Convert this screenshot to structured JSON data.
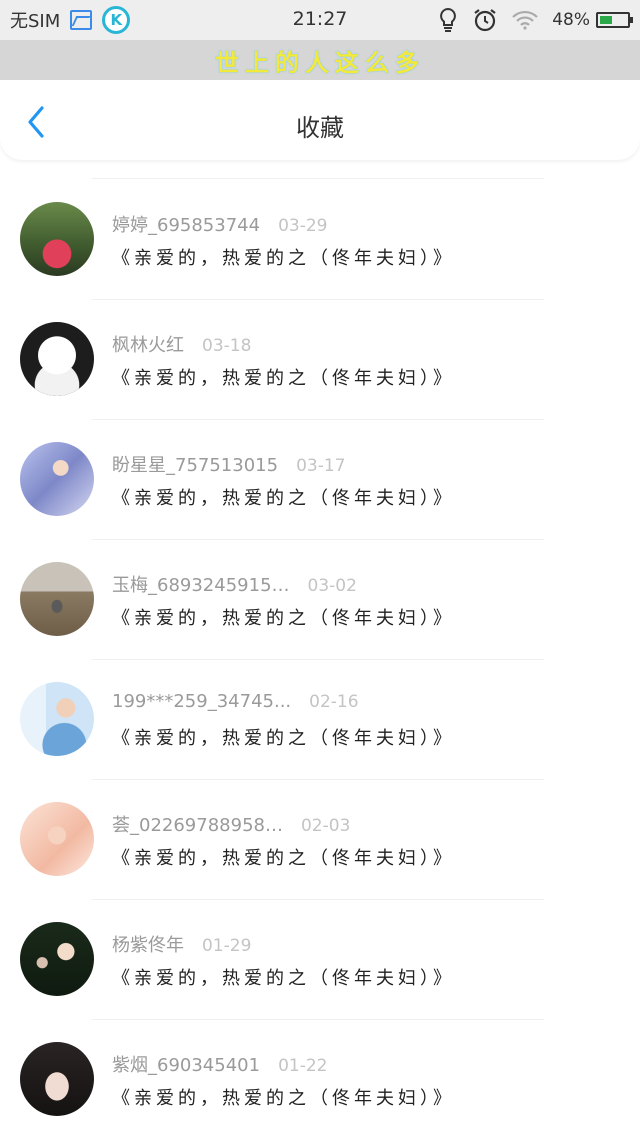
{
  "status_bar": {
    "carrier": "无SIM",
    "time": "21:27",
    "battery": "48%",
    "battery_level": 0.48,
    "app_icon_letter": "K"
  },
  "banner": {
    "text": "世上的人这么多"
  },
  "nav": {
    "title": "收藏",
    "back_icon": "chevron-left-icon"
  },
  "items": [
    {
      "name": "婷婷_695853744",
      "date": "03-29",
      "song": "《亲爱的，热爱的之（佟年夫妇）》"
    },
    {
      "name": "枫林火红",
      "date": "03-18",
      "song": "《亲爱的，热爱的之（佟年夫妇）》"
    },
    {
      "name": "盼星星_757513015",
      "date": "03-17",
      "song": "《亲爱的，热爱的之（佟年夫妇）》"
    },
    {
      "name": "玉梅_6893245915…",
      "date": "03-02",
      "song": "《亲爱的，热爱的之（佟年夫妇）》"
    },
    {
      "name": "199***259_34745...",
      "date": "02-16",
      "song": "《亲爱的，热爱的之（佟年夫妇）》"
    },
    {
      "name": "荟_02269788958…",
      "date": "02-03",
      "song": "《亲爱的，热爱的之（佟年夫妇）》"
    },
    {
      "name": "杨紫佟年",
      "date": "01-29",
      "song": "《亲爱的，热爱的之（佟年夫妇）》"
    },
    {
      "name": "紫烟_690345401",
      "date": "01-22",
      "song": "《亲爱的，热爱的之（佟年夫妇）》"
    }
  ],
  "colors": {
    "accent": "#2196f3",
    "name_text": "#9a9a9a",
    "date_text": "#c4c4c4",
    "banner_bg": "#d6d6d6",
    "banner_text": "#f2e93b"
  }
}
